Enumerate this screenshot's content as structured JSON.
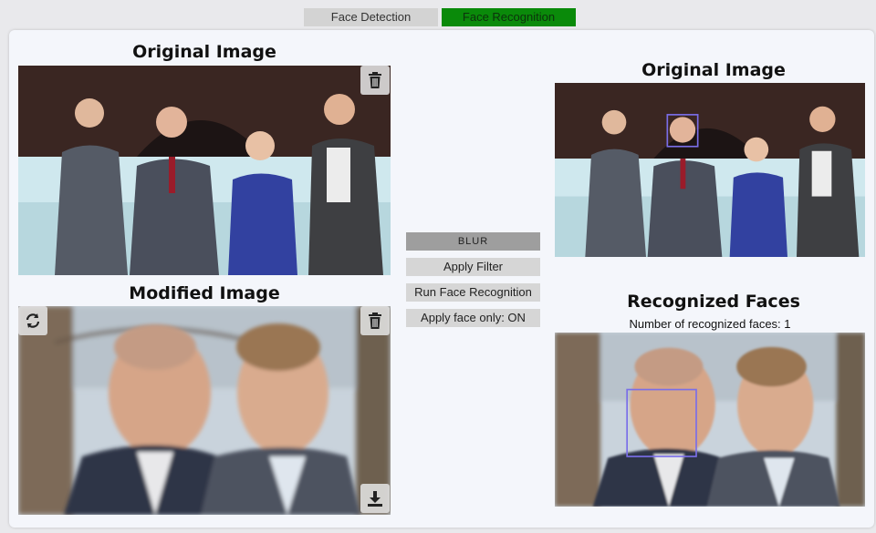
{
  "tabs": {
    "face_detection": "Face Detection",
    "face_recognition": "Face Recognition"
  },
  "left": {
    "original_title": "Original Image",
    "modified_title": "Modified Image"
  },
  "controls": {
    "blur": "BLUR",
    "apply_filter": "Apply Filter",
    "run_face_recognition": "Run Face Recognition",
    "apply_face_only": "Apply face only: ON"
  },
  "right": {
    "original_title": "Original Image",
    "recognized_title": "Recognized Faces",
    "recognized_count_text": "Number of recognized faces: 1"
  },
  "icons": {
    "delete": "trash-icon",
    "refresh": "refresh-icon",
    "download": "download-icon"
  },
  "colors": {
    "active_tab": "#0a8a0a",
    "face_box": "#7a6ee8"
  }
}
